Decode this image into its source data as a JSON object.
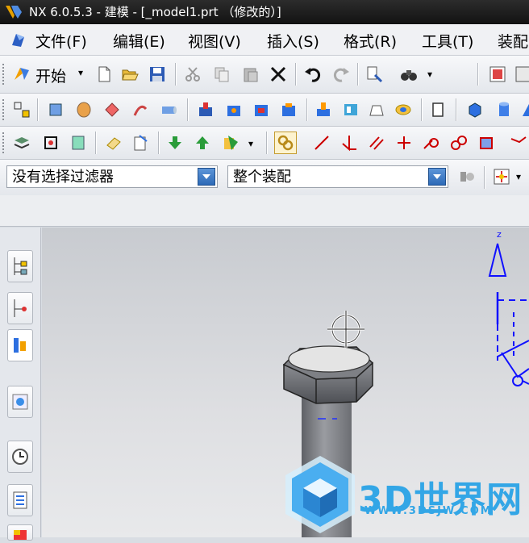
{
  "window": {
    "title": "NX 6.0.5.3 - 建模 - [_model1.prt （修改的）]"
  },
  "menu": [
    "文件(F)",
    "编辑(E)",
    "视图(V)",
    "插入(S)",
    "格式(R)",
    "工具(T)",
    "装配"
  ],
  "toolbar": {
    "start_label": "开始"
  },
  "filters": {
    "selection_filter": "没有选择过滤器",
    "scope": "整个装配"
  },
  "viewport": {
    "axis_label": "z"
  },
  "watermark": {
    "brand": "3D世界网",
    "url": "WWW.3DSJW.COM"
  },
  "colors": {
    "titlebar": "#1c1c1c",
    "axis": "#1010ff",
    "watermark": "#33a6e6"
  },
  "icons": [
    "nx-logo-icon",
    "new-file-icon",
    "open-folder-icon",
    "save-icon",
    "cut-icon",
    "copy-icon",
    "paste-icon",
    "delete-icon",
    "undo-icon",
    "redo-icon",
    "properties-icon",
    "binoculars-icon"
  ]
}
